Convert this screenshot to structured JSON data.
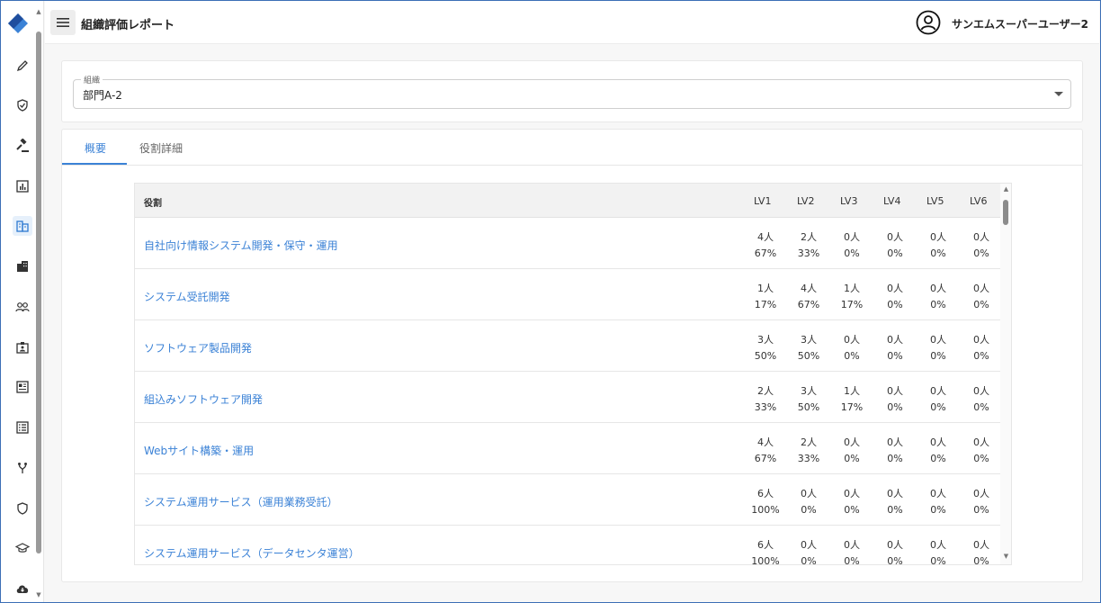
{
  "header": {
    "title": "組織評価レポート",
    "user_name": "サンエムスーパーユーザー2"
  },
  "sidebar": {
    "items": [
      {
        "icon": "pencil-icon"
      },
      {
        "icon": "shield-check-icon"
      },
      {
        "icon": "gavel-icon"
      },
      {
        "icon": "bar-chart-icon"
      },
      {
        "icon": "building-table-icon",
        "active": true
      },
      {
        "icon": "buildings-icon"
      },
      {
        "icon": "people-icon"
      },
      {
        "icon": "id-badge-icon"
      },
      {
        "icon": "profile-card-icon"
      },
      {
        "icon": "list-icon"
      },
      {
        "icon": "fork-icon"
      },
      {
        "icon": "shield-icon"
      },
      {
        "icon": "graduation-cap-icon"
      },
      {
        "icon": "cloud-download-icon"
      }
    ]
  },
  "org_select": {
    "label": "組織",
    "value": "部門A-2"
  },
  "tabs": [
    {
      "label": "概要",
      "active": true
    },
    {
      "label": "役割詳細",
      "active": false
    }
  ],
  "table": {
    "headers": [
      "役割",
      "LV1",
      "LV2",
      "LV3",
      "LV4",
      "LV5",
      "LV6"
    ],
    "rows": [
      {
        "role": "自社向け情報システム開発・保守・運用",
        "cells": [
          [
            "4人",
            "67%"
          ],
          [
            "2人",
            "33%"
          ],
          [
            "0人",
            "0%"
          ],
          [
            "0人",
            "0%"
          ],
          [
            "0人",
            "0%"
          ],
          [
            "0人",
            "0%"
          ]
        ]
      },
      {
        "role": "システム受託開発",
        "cells": [
          [
            "1人",
            "17%"
          ],
          [
            "4人",
            "67%"
          ],
          [
            "1人",
            "17%"
          ],
          [
            "0人",
            "0%"
          ],
          [
            "0人",
            "0%"
          ],
          [
            "0人",
            "0%"
          ]
        ]
      },
      {
        "role": "ソフトウェア製品開発",
        "cells": [
          [
            "3人",
            "50%"
          ],
          [
            "3人",
            "50%"
          ],
          [
            "0人",
            "0%"
          ],
          [
            "0人",
            "0%"
          ],
          [
            "0人",
            "0%"
          ],
          [
            "0人",
            "0%"
          ]
        ]
      },
      {
        "role": "組込みソフトウェア開発",
        "cells": [
          [
            "2人",
            "33%"
          ],
          [
            "3人",
            "50%"
          ],
          [
            "1人",
            "17%"
          ],
          [
            "0人",
            "0%"
          ],
          [
            "0人",
            "0%"
          ],
          [
            "0人",
            "0%"
          ]
        ]
      },
      {
        "role": "Webサイト構築・運用",
        "cells": [
          [
            "4人",
            "67%"
          ],
          [
            "2人",
            "33%"
          ],
          [
            "0人",
            "0%"
          ],
          [
            "0人",
            "0%"
          ],
          [
            "0人",
            "0%"
          ],
          [
            "0人",
            "0%"
          ]
        ]
      },
      {
        "role": "システム運用サービス（運用業務受託）",
        "cells": [
          [
            "6人",
            "100%"
          ],
          [
            "0人",
            "0%"
          ],
          [
            "0人",
            "0%"
          ],
          [
            "0人",
            "0%"
          ],
          [
            "0人",
            "0%"
          ],
          [
            "0人",
            "0%"
          ]
        ]
      },
      {
        "role": "システム運用サービス（データセンタ運営）",
        "cells": [
          [
            "6人",
            "100%"
          ],
          [
            "0人",
            "0%"
          ],
          [
            "0人",
            "0%"
          ],
          [
            "0人",
            "0%"
          ],
          [
            "0人",
            "0%"
          ],
          [
            "0人",
            "0%"
          ]
        ]
      }
    ]
  },
  "colors": {
    "accent": "#3b82d6",
    "frame": "#3c6fb6",
    "logo_dark": "#1f4e9e",
    "logo_light": "#3b82d6"
  }
}
